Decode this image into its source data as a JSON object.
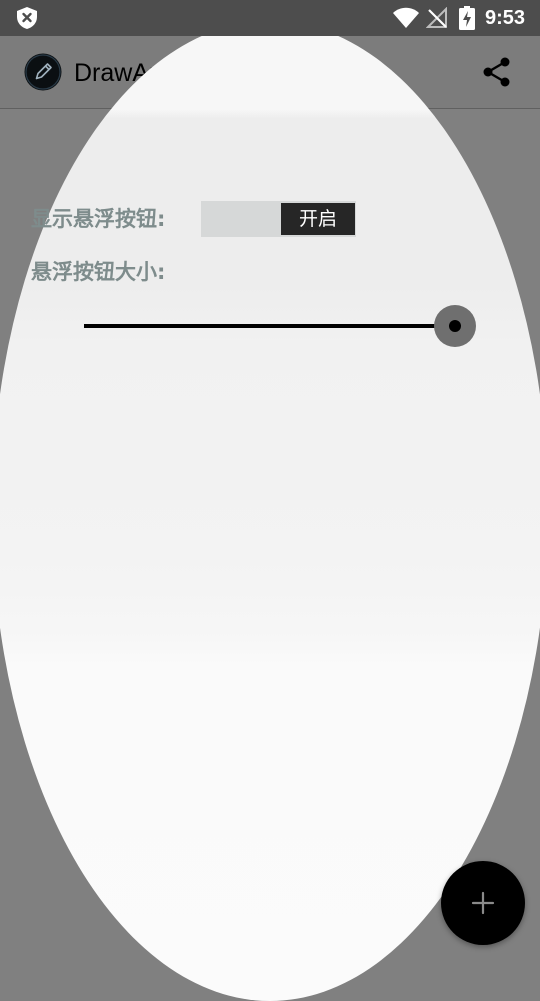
{
  "status_bar": {
    "time": "9:53",
    "icons": [
      "shield-x-icon",
      "wifi-icon",
      "no-signal-icon",
      "battery-charging-icon"
    ]
  },
  "app_bar": {
    "title": "DrawAnyWhere",
    "app_icon": "pencil-icon",
    "share_icon": "share-icon"
  },
  "settings": {
    "show_floating_button_label": "显示悬浮按钮:",
    "toggle_state_label": "开启",
    "floating_button_size_label": "悬浮按钮大小:",
    "floating_button_size_value": 1.0
  },
  "fab": {
    "icon": "plus-icon"
  },
  "colors": {
    "background_dim": "#808080",
    "status_bar": "#4d4d4d",
    "app_bar": "#7c7c7c",
    "label_text": "#7e8c8c",
    "toggle_track": "#d6d8d8",
    "toggle_thumb": "#262626",
    "slider_track": "#000000",
    "fab": "#000000"
  }
}
